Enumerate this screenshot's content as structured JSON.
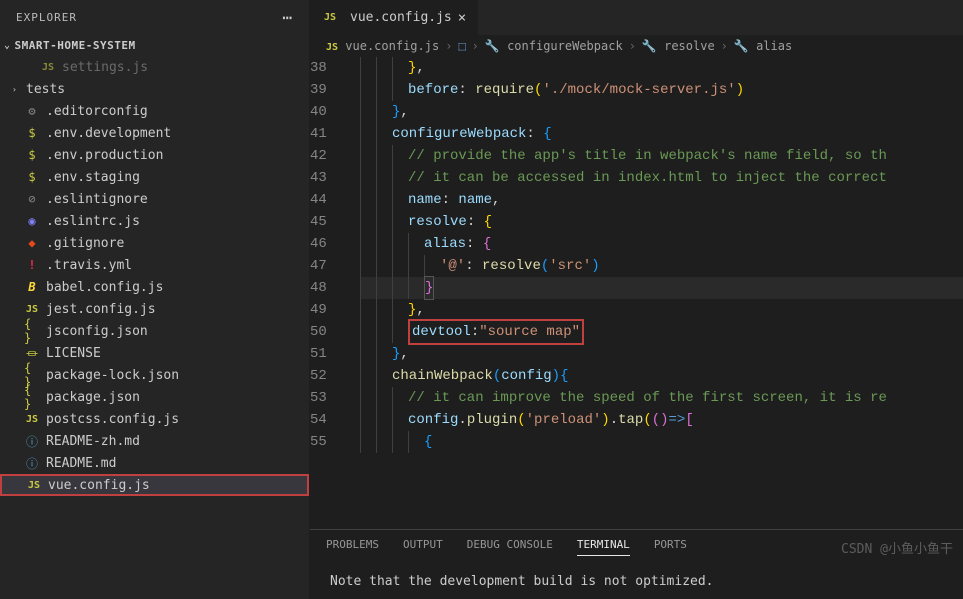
{
  "explorer": {
    "title": "EXPLORER",
    "workspace": "SMART-HOME-SYSTEM",
    "files": [
      {
        "name": "settings.js",
        "icon": "js",
        "cut": true,
        "indent": 1
      },
      {
        "name": "tests",
        "icon": "folder",
        "type": "folder"
      },
      {
        "name": ".editorconfig",
        "icon": "gear"
      },
      {
        "name": ".env.development",
        "icon": "dollar"
      },
      {
        "name": ".env.production",
        "icon": "dollar"
      },
      {
        "name": ".env.staging",
        "icon": "dollar"
      },
      {
        "name": ".eslintignore",
        "icon": "eslint-ignore"
      },
      {
        "name": ".eslintrc.js",
        "icon": "eslint"
      },
      {
        "name": ".gitignore",
        "icon": "git"
      },
      {
        "name": ".travis.yml",
        "icon": "yml"
      },
      {
        "name": "babel.config.js",
        "icon": "babel"
      },
      {
        "name": "jest.config.js",
        "icon": "js"
      },
      {
        "name": "jsconfig.json",
        "icon": "json"
      },
      {
        "name": "LICENSE",
        "icon": "license"
      },
      {
        "name": "package-lock.json",
        "icon": "json"
      },
      {
        "name": "package.json",
        "icon": "json"
      },
      {
        "name": "postcss.config.js",
        "icon": "js"
      },
      {
        "name": "README-zh.md",
        "icon": "info"
      },
      {
        "name": "README.md",
        "icon": "info"
      },
      {
        "name": "vue.config.js",
        "icon": "js",
        "selected": true
      }
    ]
  },
  "tabs": {
    "active": {
      "icon": "JS",
      "label": "vue.config.js"
    }
  },
  "breadcrumb": {
    "items": [
      {
        "icon": "JS",
        "label": "vue.config.js"
      },
      {
        "icon": "cube",
        "label": "<unknown>"
      },
      {
        "icon": "wrench",
        "label": "configureWebpack"
      },
      {
        "icon": "wrench",
        "label": "resolve"
      },
      {
        "icon": "wrench",
        "label": "alias"
      }
    ]
  },
  "chart_data": {
    "type": "table",
    "description": "VS Code editor showing vue.config.js lines 38-55",
    "lines": [
      {
        "num": 38,
        "text": "      },"
      },
      {
        "num": 39,
        "text": "      before: require('./mock/mock-server.js')"
      },
      {
        "num": 40,
        "text": "    },"
      },
      {
        "num": 41,
        "text": "    configureWebpack: {"
      },
      {
        "num": 42,
        "text": "      // provide the app's title in webpack's name field, so th"
      },
      {
        "num": 43,
        "text": "      // it can be accessed in index.html to inject the correct"
      },
      {
        "num": 44,
        "text": "      name: name,"
      },
      {
        "num": 45,
        "text": "      resolve: {"
      },
      {
        "num": 46,
        "text": "        alias: {"
      },
      {
        "num": 47,
        "text": "          '@': resolve('src')"
      },
      {
        "num": 48,
        "text": "        }"
      },
      {
        "num": 49,
        "text": "      },"
      },
      {
        "num": 50,
        "text": "      devtool:\"source map\""
      },
      {
        "num": 51,
        "text": "    },"
      },
      {
        "num": 52,
        "text": "    chainWebpack(config) {"
      },
      {
        "num": 53,
        "text": "      // it can improve the speed of the first screen, it is re"
      },
      {
        "num": 54,
        "text": "      config.plugin('preload').tap(() => ["
      },
      {
        "num": 55,
        "text": "        {"
      }
    ],
    "highlighted_line": 48,
    "red_box_line": 50,
    "red_box_content": "devtool:\"source map\""
  },
  "panel": {
    "tabs": [
      "PROBLEMS",
      "OUTPUT",
      "DEBUG CONSOLE",
      "TERMINAL",
      "PORTS"
    ],
    "active": "TERMINAL",
    "terminal_text": "Note that the development build is not optimized."
  },
  "watermark": "CSDN @小鱼小鱼干"
}
